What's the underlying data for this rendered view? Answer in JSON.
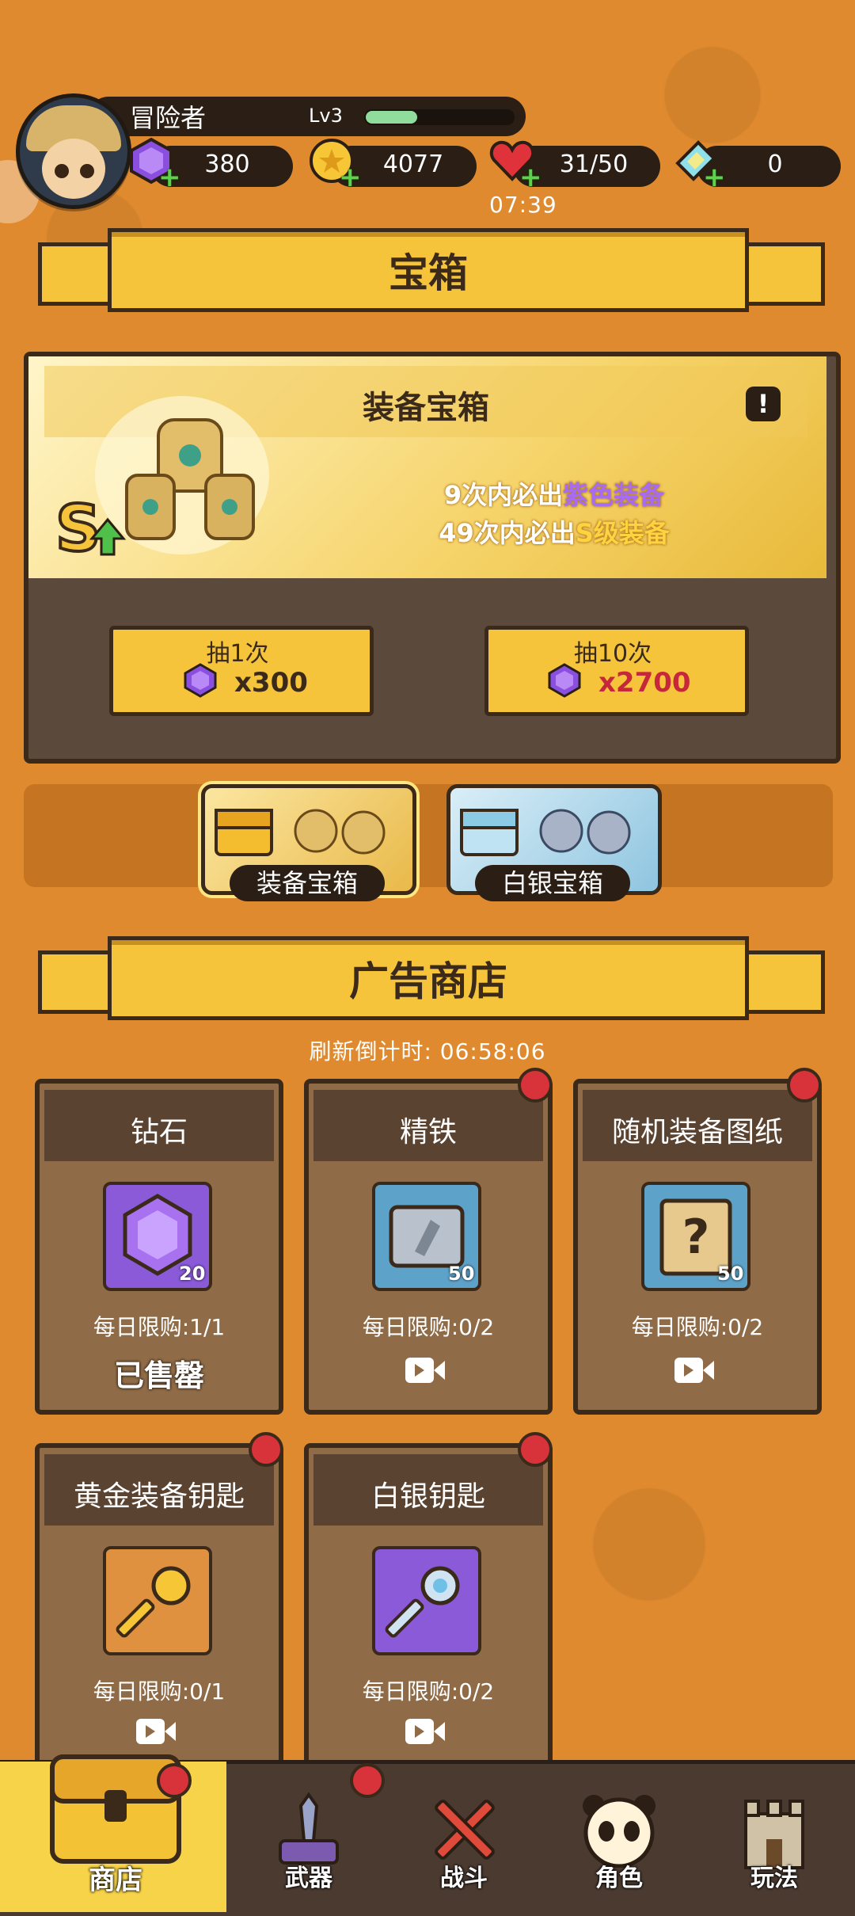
{
  "player": {
    "name": "冒险者",
    "level": "Lv3",
    "xp_fraction": 0.35
  },
  "resources": {
    "gems": "380",
    "coins": "4077",
    "energy": "31/50",
    "tickets": "0",
    "energy_timer": "07:39"
  },
  "sections": {
    "treasure": "宝箱",
    "ad_shop": "广告商店"
  },
  "chest": {
    "title": "装备宝箱",
    "info_icon": "!",
    "pity_line1": {
      "count": "9",
      "prefix": "次内必出",
      "item": "紫色装备"
    },
    "pity_line2": {
      "count": "49",
      "prefix": "次内必出",
      "item": "S级装备"
    },
    "pull_one": {
      "label": "抽1次",
      "cost": "x300"
    },
    "pull_ten": {
      "label": "抽10次",
      "cost": "x2700"
    }
  },
  "chest_tabs": [
    "装备宝箱",
    "白银宝箱"
  ],
  "ad_shop": {
    "countdown_label": "刷新倒计时:",
    "countdown_value": "06:58:06",
    "items": [
      {
        "title": "钻石",
        "qty": "20",
        "limit": "每日限购:1/1",
        "status": "已售罄"
      },
      {
        "title": "精铁",
        "qty": "50",
        "limit": "每日限购:0/2"
      },
      {
        "title": "随机装备图纸",
        "qty": "50",
        "limit": "每日限购:0/2"
      },
      {
        "title": "黄金装备钥匙",
        "limit": "每日限购:0/1"
      },
      {
        "title": "白银钥匙",
        "limit": "每日限购:0/2"
      }
    ]
  },
  "nav": [
    "商店",
    "武器",
    "战斗",
    "角色",
    "玩法"
  ],
  "colors": {
    "background": "#e08a2f",
    "gold": "#f5c43a",
    "purple_text": "#a86cf2",
    "red_dot": "#d8333a"
  }
}
